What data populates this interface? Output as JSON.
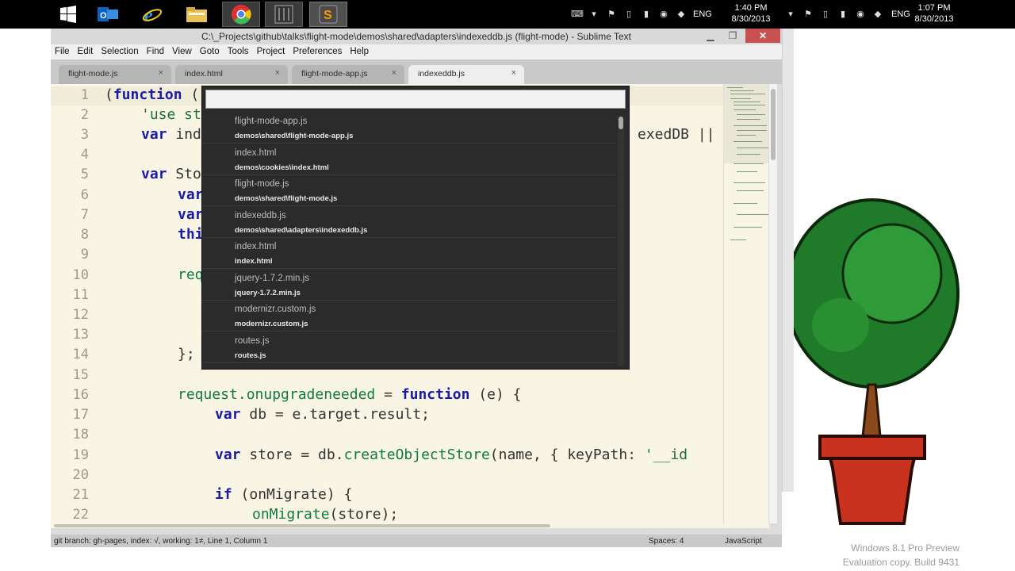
{
  "taskbar": {
    "apps": [
      {
        "name": "windows-start-icon"
      },
      {
        "name": "outlook-icon"
      },
      {
        "name": "internet-explorer-icon"
      },
      {
        "name": "file-explorer-icon"
      },
      {
        "name": "chrome-icon"
      },
      {
        "name": "calculator-icon"
      },
      {
        "name": "sublime-text-icon"
      }
    ],
    "tray_left": {
      "language": "ENG",
      "time": "1:40 PM",
      "date": "8/30/2013"
    },
    "tray_right": {
      "language": "ENG",
      "time": "1:07 PM",
      "date": "8/30/2013"
    }
  },
  "window": {
    "title": "C:\\_Projects\\github\\talks\\flight-mode\\demos\\shared\\adapters\\indexeddb.js (flight-mode) - Sublime Text",
    "menu": [
      "File",
      "Edit",
      "Selection",
      "Find",
      "View",
      "Goto",
      "Tools",
      "Project",
      "Preferences",
      "Help"
    ],
    "tabs": [
      {
        "label": "flight-mode.js",
        "close": "×"
      },
      {
        "label": "index.html",
        "close": "×"
      },
      {
        "label": "flight-mode-app.js",
        "close": "×"
      },
      {
        "label": "indexeddb.js",
        "close": "×"
      }
    ],
    "status": {
      "left": "git branch: gh-pages, index: √, working: 1≠, Line 1, Column 1",
      "spaces": "Spaces: 4",
      "syntax": "JavaScript"
    }
  },
  "editor": {
    "line_numbers": [
      "1",
      "2",
      "3",
      "4",
      "5",
      "6",
      "7",
      "8",
      "9",
      "10",
      "11",
      "12",
      "13",
      "14",
      "15",
      "16",
      "17",
      "18",
      "19",
      "20",
      "21",
      "22"
    ],
    "code": {
      "l1": [
        "(",
        "function",
        " ("
      ],
      "l2": [
        "'use st"
      ],
      "l3": [
        "var",
        " ind",
        "exedDB || g"
      ],
      "l5": [
        "var",
        " Sto"
      ],
      "l6": [
        "var"
      ],
      "l7": [
        "var"
      ],
      "l8": [
        "thi"
      ],
      "l10": [
        "req"
      ],
      "l14": [
        "};"
      ],
      "l16": [
        "request.",
        "onupgradeneeded",
        " = ",
        "function",
        " (e) {"
      ],
      "l17": [
        "var",
        " db = e.target.result;"
      ],
      "l19": [
        "var",
        " store = db.",
        "createObjectStore",
        "(name, { keyPath: ",
        "'__id"
      ],
      "l21": [
        "if",
        " (onMigrate) {"
      ],
      "l22": [
        "onMigrate",
        "(store);"
      ]
    }
  },
  "goto_anything": {
    "input_value": "",
    "items": [
      {
        "title": "flight-mode-app.js",
        "path": "demos\\shared\\flight-mode-app.js"
      },
      {
        "title": "index.html",
        "path": "demos\\cookies\\index.html"
      },
      {
        "title": "flight-mode.js",
        "path": "demos\\shared\\flight-mode.js"
      },
      {
        "title": "indexeddb.js",
        "path": "demos\\shared\\adapters\\indexeddb.js"
      },
      {
        "title": "index.html",
        "path": "index.html"
      },
      {
        "title": "jquery-1.7.2.min.js",
        "path": "jquery-1.7.2.min.js"
      },
      {
        "title": "modernizr.custom.js",
        "path": "modernizr.custom.js"
      },
      {
        "title": "routes.js",
        "path": "routes.js"
      }
    ]
  },
  "desktop": {
    "watermark_line1": "Windows 8.1 Pro Preview",
    "watermark_line2": "Evaluation copy. Build 9431"
  },
  "colors": {
    "editor_bg": "#f8f5e4",
    "keyword": "#1a1aa6",
    "function": "#0f7a43",
    "popup_bg": "#2b2b2b",
    "close_button": "#c75050"
  }
}
